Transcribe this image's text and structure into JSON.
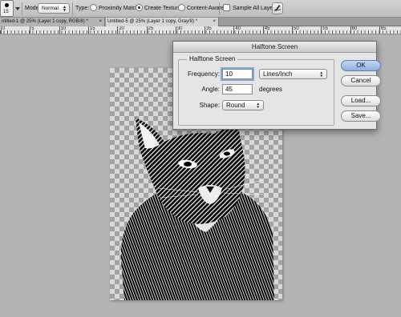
{
  "options_bar": {
    "brush_size": "15",
    "mode_label": "Mode:",
    "mode_value": "Normal",
    "type_label": "Type:",
    "type_options": [
      "Proximity Match",
      "Create Texture",
      "Content-Aware"
    ],
    "type_selected": "Create Texture",
    "sample_all_layers_label": "Sample All Layers",
    "sample_all_layers_checked": false,
    "pressure_icon": "pen-pressure-icon"
  },
  "tabs": [
    {
      "label": "ntitled-1 @ 25% (Layer 1 copy, RGB/8) *",
      "close": "×",
      "active": false
    },
    {
      "label": "Untitled-5 @ 25% (Layer 1 copy, Gray/8) *",
      "close": "×",
      "active": true
    }
  ],
  "ruler": {
    "labels": [
      "0",
      "5",
      "10",
      "15",
      "20",
      "25",
      "30",
      "35",
      "40",
      "45",
      "50",
      "55",
      "60",
      "65"
    ]
  },
  "dialog": {
    "title": "Halftone Screen",
    "group_title": "Halftone Screen",
    "frequency": {
      "label": "Frequency:",
      "value": "10",
      "unit": "Lines/Inch"
    },
    "angle": {
      "label": "Angle:",
      "value": "45",
      "unit": "degrees"
    },
    "shape": {
      "label": "Shape:",
      "value": "Round"
    },
    "buttons": {
      "ok": "OK",
      "cancel": "Cancel",
      "load": "Load...",
      "save": "Save..."
    }
  },
  "colors": {
    "canvas_bg": "#b4b4b4",
    "dialog_bg": "#e5e5e5",
    "default_button": "#8eaede",
    "focus_ring": "#7fa8dc"
  }
}
